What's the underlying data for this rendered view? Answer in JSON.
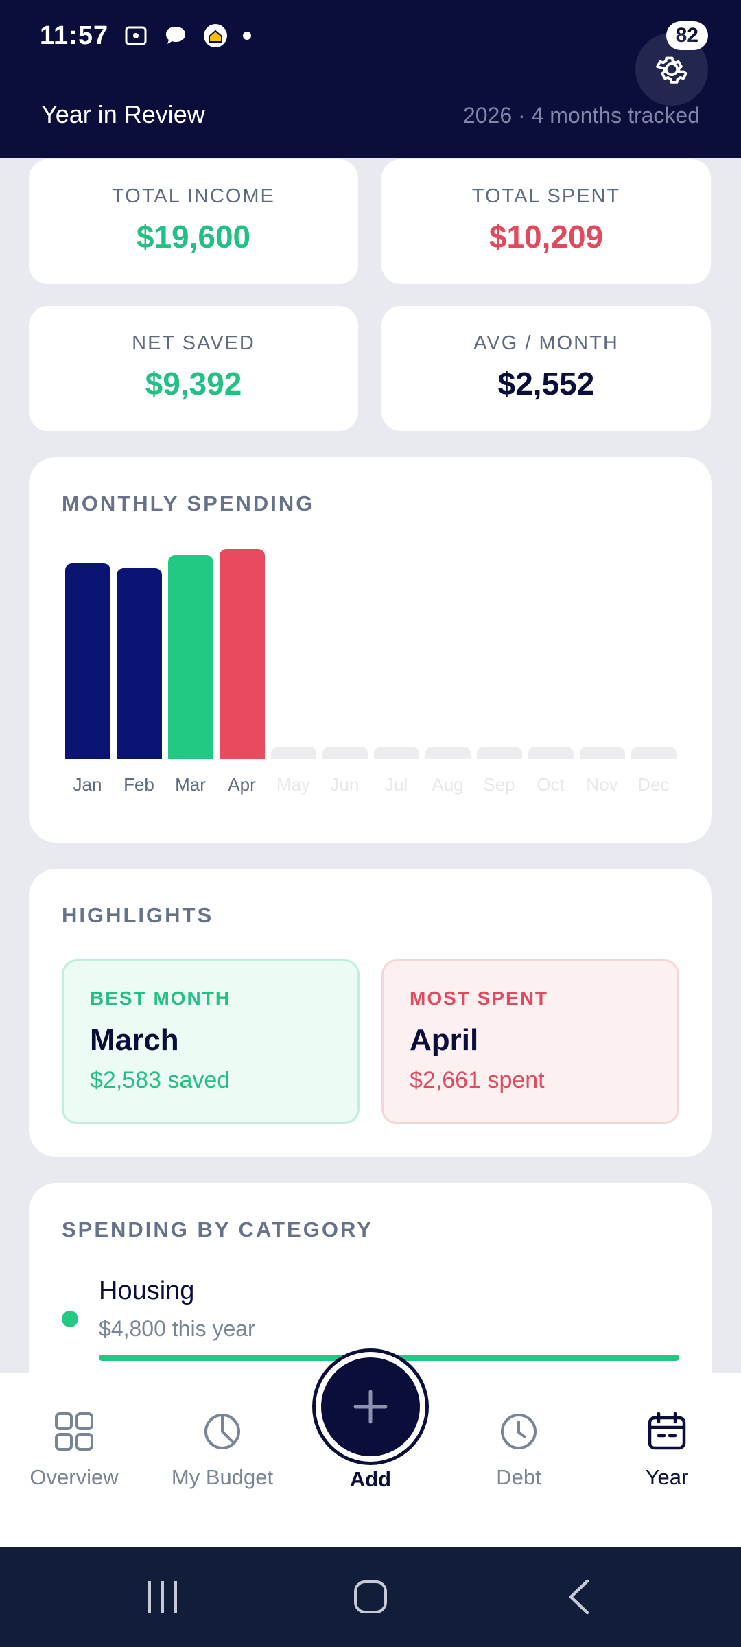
{
  "status_bar": {
    "time": "11:57",
    "battery": "82"
  },
  "header": {
    "title": "Year in Review",
    "subtitle": "2026 · 4 months tracked"
  },
  "stats": [
    {
      "label": "TOTAL INCOME",
      "value": "$19,600",
      "color": "#22c083"
    },
    {
      "label": "TOTAL SPENT",
      "value": "$10,209",
      "color": "#e0495e"
    },
    {
      "label": "NET SAVED",
      "value": "$9,392",
      "color": "#22c083"
    },
    {
      "label": "AVG / MONTH",
      "value": "$2,552",
      "color": "#0b0e3b"
    }
  ],
  "monthly": {
    "title": "MONTHLY SPENDING"
  },
  "chart_data": {
    "type": "bar",
    "categories": [
      "Jan",
      "Feb",
      "Mar",
      "Apr",
      "May",
      "Jun",
      "Jul",
      "Aug",
      "Sep",
      "Oct",
      "Nov",
      "Dec"
    ],
    "values": [
      2480,
      2420,
      2583,
      2661,
      null,
      null,
      null,
      null,
      null,
      null,
      null,
      null
    ],
    "bar_colors": [
      "#0a1472",
      "#0a1472",
      "#22c983",
      "#ea4a5e",
      "#ededf0",
      "#ededf0",
      "#ededf0",
      "#ededf0",
      "#ededf0",
      "#ededf0",
      "#ededf0",
      "#ededf0"
    ],
    "title": "MONTHLY SPENDING",
    "ylim": [
      0,
      2700
    ]
  },
  "highlights": {
    "title": "HIGHLIGHTS",
    "best": {
      "label": "BEST MONTH",
      "month": "March",
      "detail": "$2,583 saved"
    },
    "most": {
      "label": "MOST SPENT",
      "month": "April",
      "detail": "$2,661 spent"
    }
  },
  "category": {
    "title": "SPENDING BY CATEGORY",
    "items": [
      {
        "name": "Housing",
        "detail": "$4,800 this year",
        "color": "#22c983"
      }
    ]
  },
  "nav": {
    "items": [
      {
        "label": "Overview",
        "icon": "grid-icon"
      },
      {
        "label": "My Budget",
        "icon": "pie-chart-icon"
      },
      {
        "label": "Add",
        "icon": "plus-icon"
      },
      {
        "label": "Debt",
        "icon": "clock-icon"
      },
      {
        "label": "Year",
        "icon": "calendar-icon"
      }
    ],
    "active": "Year"
  }
}
